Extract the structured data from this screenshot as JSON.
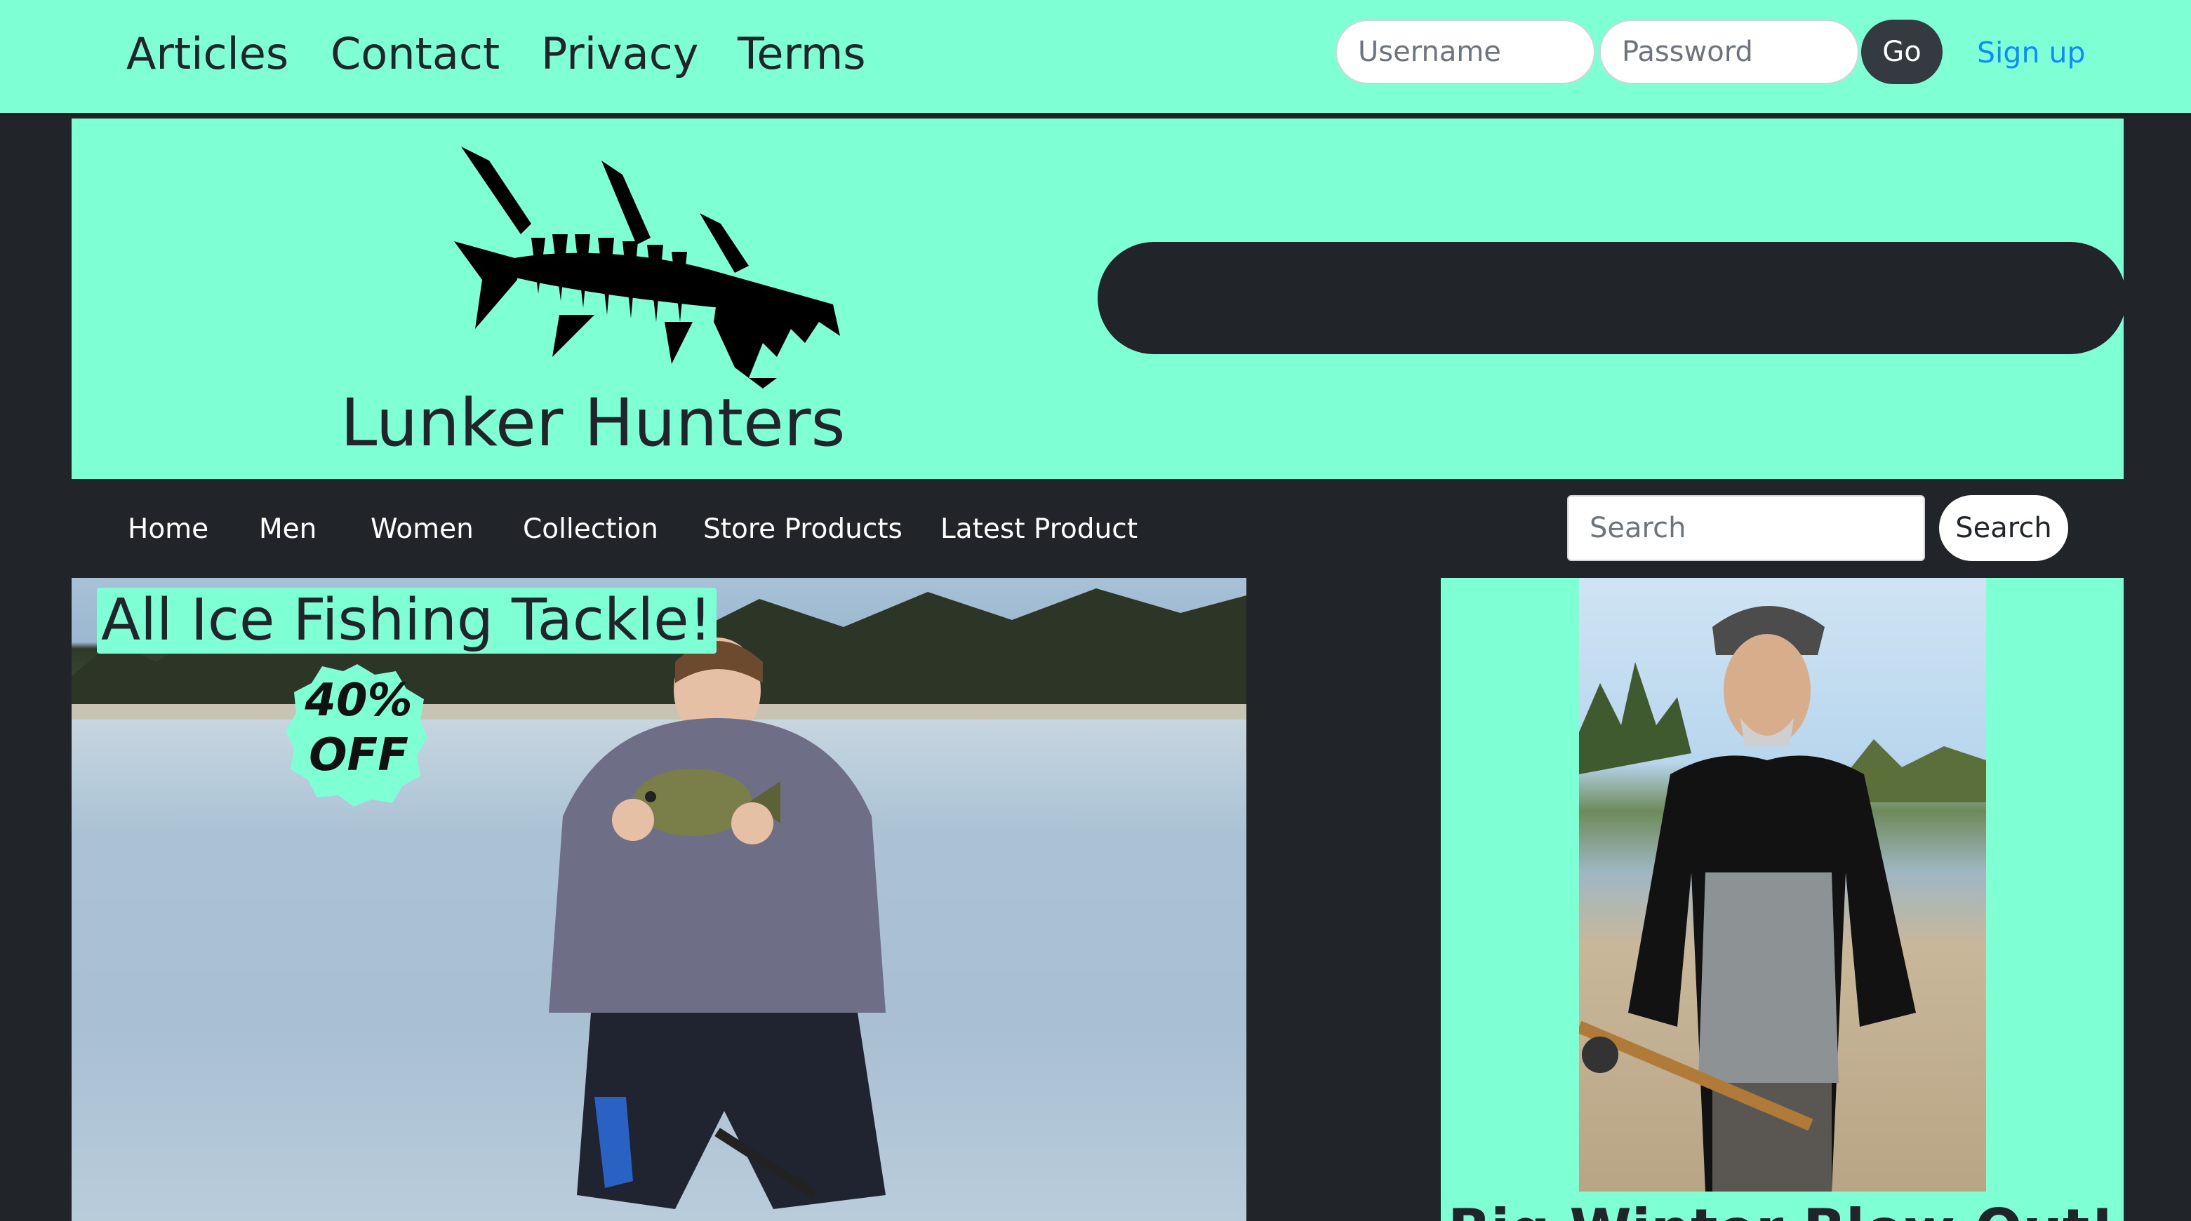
{
  "top_nav": {
    "links": [
      "Articles",
      "Contact",
      "Privacy",
      "Terms"
    ],
    "username_placeholder": "Username",
    "password_placeholder": "Password",
    "go_label": "Go",
    "signup_label": "Sign up"
  },
  "brand": {
    "name": "Lunker Hunters",
    "logo_icon": "fish-skeleton-icon"
  },
  "main_nav": {
    "links": [
      "Home",
      "Men",
      "Women",
      "Collection",
      "Store Products",
      "Latest Product"
    ],
    "search_placeholder": "Search",
    "search_button": "Search"
  },
  "hero": {
    "title": "All Ice Fishing Tackle!",
    "badge_line1": "40%",
    "badge_line2": "OFF"
  },
  "side_card": {
    "title": "Big Winter Blow Out!"
  },
  "colors": {
    "accent": "#7fffd4",
    "dark": "#212529",
    "link": "#0d8bff"
  }
}
